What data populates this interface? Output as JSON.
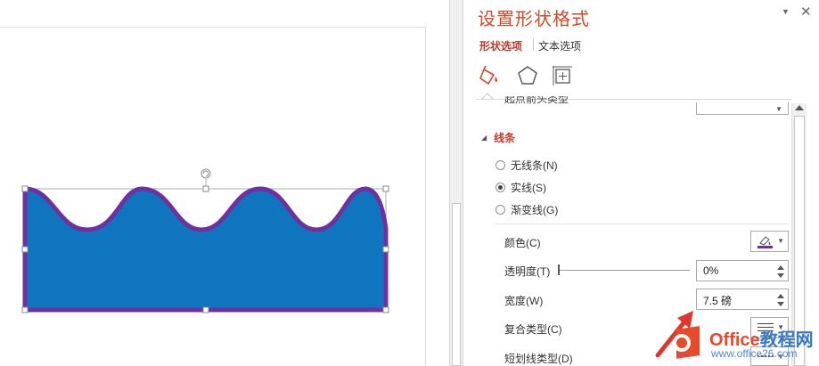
{
  "pane": {
    "title": "设置形状格式",
    "dropdown_icon": "chevron-down-icon",
    "close_icon": "close-icon",
    "tabs": {
      "shape_options": "形状选项",
      "text_options": "文本选项"
    },
    "category_icons": [
      "fill-line-icon",
      "effects-pentagon-icon",
      "size-properties-icon"
    ],
    "cut_row_label": "起点箭头类型"
  },
  "line_section": {
    "header": "线条",
    "radios": [
      {
        "label": "无线条(N)",
        "selected": false
      },
      {
        "label": "实线(S)",
        "selected": true
      },
      {
        "label": "渐变线(G)",
        "selected": false
      }
    ],
    "color_label": "颜色(C)",
    "transparency_label": "透明度(T)",
    "transparency_value": "0%",
    "width_label": "宽度(W)",
    "width_value": "7.5 磅",
    "compound_label": "复合类型(C)",
    "dash_label": "短划线类型(D)"
  },
  "shape": {
    "fill_color": "#0f75be",
    "line_color": "#7030a0"
  },
  "watermark": {
    "title_part1": "Office",
    "title_part2": "教程网",
    "url": "www.office26.com"
  }
}
